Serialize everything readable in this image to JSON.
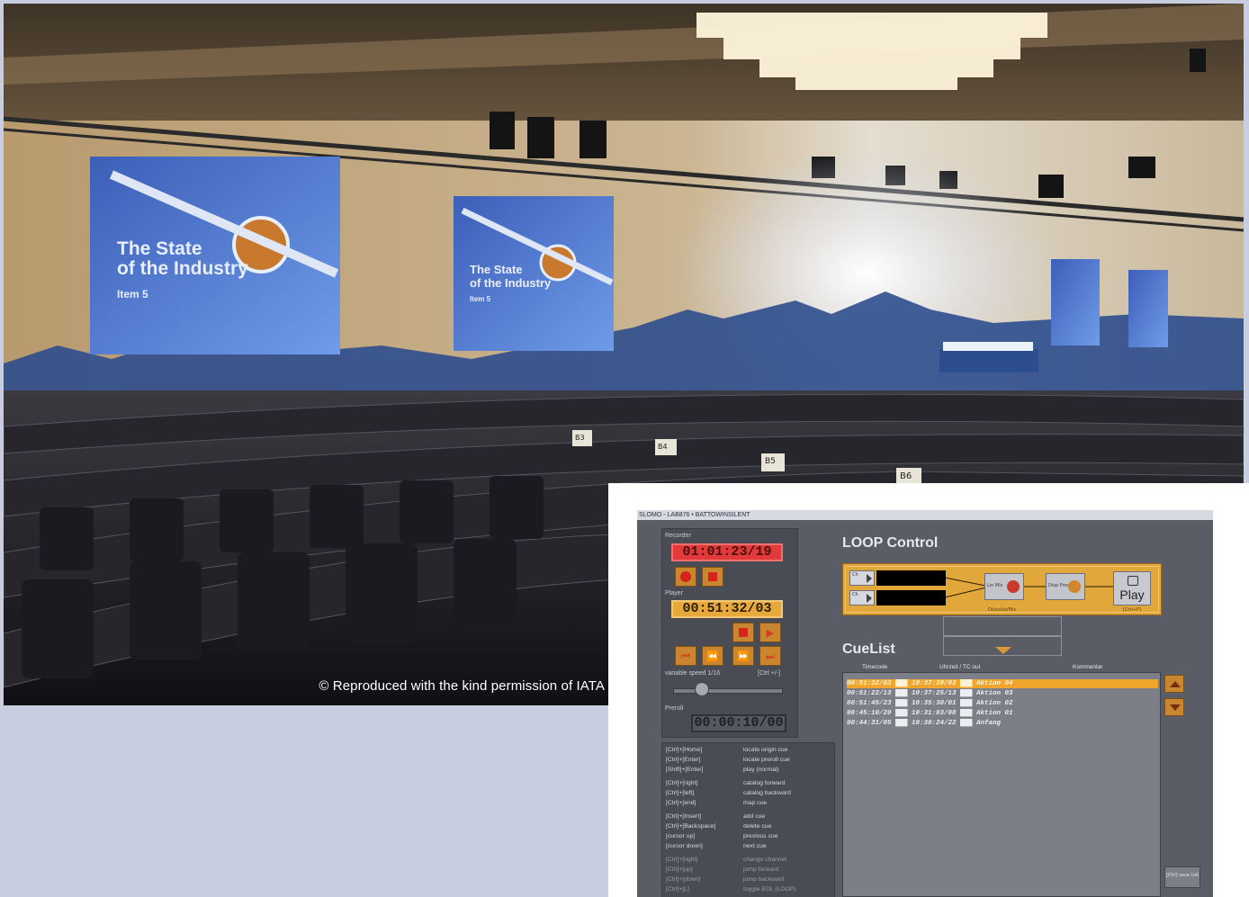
{
  "photo": {
    "credit": "© Reproduced with the kind permission of IATA",
    "slide": {
      "title_line1": "The State",
      "title_line2": "of the Industry",
      "subtitle": "Item 5"
    },
    "seat_labels": [
      "B3",
      "B4",
      "B5",
      "B6"
    ]
  },
  "app": {
    "title": "SLOMO - LAB876 • BATTOWINSILENT",
    "recorder_label": "Recorder",
    "recorder_time": "01:01:23/19",
    "player_label": "Player",
    "player_time": "00:51:32/03",
    "variable_speed_label": "variable speed 1/16",
    "variable_speed_shortcut": "[Ctrl +/-]",
    "preroll_label": "Preroll",
    "preroll_time": "00:00:10/00",
    "shortcuts": [
      {
        "key": "[Ctrl]+[Home]",
        "action": "locate origin cue"
      },
      {
        "key": "[Ctrl]+[Enter]",
        "action": "locate preroll cue"
      },
      {
        "key": "[Shift]+[Enter]",
        "action": "play (normal)"
      },
      {
        "key": "[Ctrl]+[right]",
        "action": "catalog forward"
      },
      {
        "key": "[Ctrl]+[left]",
        "action": "catalog backward"
      },
      {
        "key": "[Ctrl]+[end]",
        "action": "map cue"
      },
      {
        "key": "[Ctrl]+[Insert]",
        "action": "add cue"
      },
      {
        "key": "[Ctrl]+[Backspace]",
        "action": "delete cue"
      },
      {
        "key": "[cursor up]",
        "action": "previous cue"
      },
      {
        "key": "[cursor down]",
        "action": "next cue"
      },
      {
        "key": "[Ctrl]+[right]",
        "action": "change channel"
      },
      {
        "key": "[Ctrl]+[up]",
        "action": "jump forward"
      },
      {
        "key": "[Ctrl]+[down]",
        "action": "jump backward"
      },
      {
        "key": "[Ctrl]+[L]",
        "action": "toggle EDL (LOOP)"
      }
    ],
    "loop": {
      "title": "LOOP Control",
      "channel_label": "Ch",
      "node1_label": "Lin Mix",
      "node2_label": "Disp Proc",
      "mid_label": "Dissolve/Mix",
      "play_label": "Play",
      "play_shortcut": "[Ctrl+P]"
    },
    "cuelist": {
      "title": "CueList",
      "headers": [
        "Timecode",
        "Uhrzeit / TC out",
        "Kommentar"
      ],
      "rows": [
        "00:51:32/03 ███ 10:37:39/03 ███ Aktion 04",
        "00:51:22/13 ███ 10:37:25/13 ███ Aktion 03",
        "00:51:45/23 ███ 10:35:38/01 ███ Aktion 02",
        "00:45:10/20 ███ 10:31:03/08 ███ Aktion 01",
        "00:44:31/05 ███ 10:30:24/22 ███ Anfang"
      ],
      "save_label": "[Ctrl] save List"
    },
    "colors": {
      "accent": "#e2a73b",
      "recorder": "#e23a3a",
      "selected_row": "#f0a62c"
    }
  }
}
